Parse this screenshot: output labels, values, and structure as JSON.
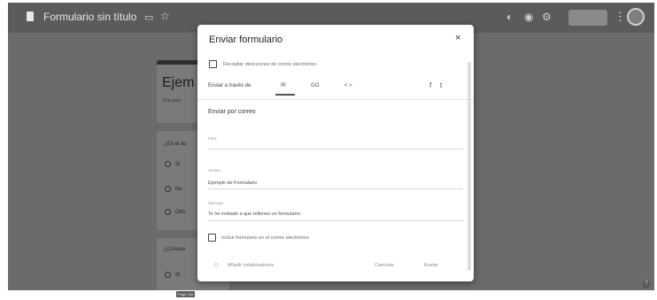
{
  "app": {
    "doc_title": "Formulario sin título",
    "card_title": "Ejem",
    "card_sub": "Tine para",
    "question1": "¿En el au",
    "options": [
      "Si",
      "No",
      "Otro"
    ],
    "question2": "¿Conoce",
    "option2": "Si",
    "tooltip": "Page 116"
  },
  "dialog": {
    "title": "Enviar formulario",
    "close": "×",
    "collect_label": "Recopilar direcciones de correo electrónico",
    "send_via": "Enviar a través de",
    "tabs": {
      "email": "✉",
      "link": "GO",
      "embed": "< >"
    },
    "social": {
      "facebook": "f",
      "twitter": "t"
    },
    "section": "Enviar por correo",
    "to_label": "Para",
    "subject_label": "Asunto",
    "subject_value": "Ejemplo de Formulario",
    "message_label": "Mensaje",
    "message_value": "Te he invitado a que rellenes un formulario:",
    "include_label": "Incluir formulario en el correo electrónico",
    "collaborators": "Añadir colaboradores",
    "cancel": "Cancelar",
    "send": "Enviar"
  }
}
